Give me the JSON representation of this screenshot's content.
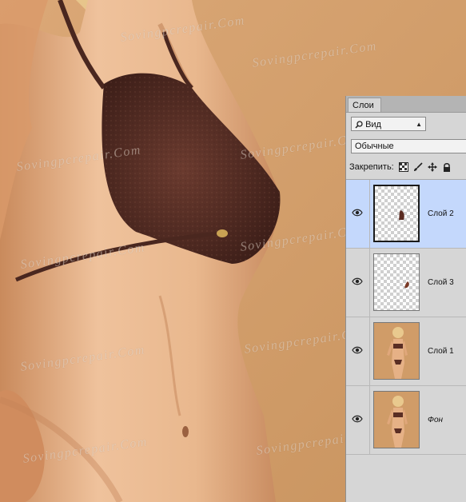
{
  "canvas": {
    "watermark": "Sovingpcrepair.Com"
  },
  "layers_panel": {
    "tab_label": "Слои",
    "filter": {
      "label": "Вид",
      "icon": "search-icon"
    },
    "blend_mode": "Обычные",
    "lock_label": "Закрепить:",
    "lock_icons": [
      "lock-transparent-icon",
      "lock-paint-icon",
      "lock-move-icon",
      "lock-all-icon"
    ],
    "layers": [
      {
        "name": "Слой 2",
        "selected": true,
        "thumb": "transparent-small-shape"
      },
      {
        "name": "Слой 3",
        "selected": false,
        "thumb": "transparent-tiny-shape"
      },
      {
        "name": "Слой 1",
        "selected": false,
        "thumb": "photo"
      },
      {
        "name": "Фон",
        "selected": false,
        "thumb": "photo"
      }
    ]
  },
  "colors": {
    "background": "#d2a070",
    "skin": "#e8b48a",
    "bikini": "#5a3026",
    "selection": "#c4d8fc"
  }
}
